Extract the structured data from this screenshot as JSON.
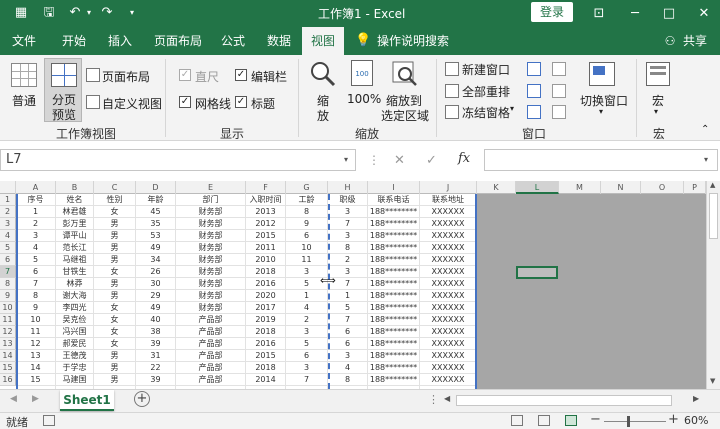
{
  "title": "工作簿1 - Excel",
  "login_label": "登录",
  "tabs": [
    "文件",
    "开始",
    "插入",
    "页面布局",
    "公式",
    "数据",
    "视图",
    "操作说明搜索"
  ],
  "share_label": "共享",
  "ribbon": {
    "views": {
      "normal": "普通",
      "page_break": [
        "分页",
        "预览"
      ],
      "page_layout": "页面布局",
      "custom_views": "自定义视图",
      "label": "工作簿视图"
    },
    "show": {
      "ruler": "直尺",
      "gridlines": "网格线",
      "formula_bar": "编辑栏",
      "headings": "标题",
      "label": "显示"
    },
    "zoom": {
      "zoom": [
        "缩",
        "放"
      ],
      "hundred": "100%",
      "zoom_sel": [
        "缩放到",
        "选定区域"
      ],
      "label": "缩放"
    },
    "window": {
      "new_window": "新建窗口",
      "arrange_all": "全部重排",
      "freeze": "冻结窗格",
      "switch": "切换窗口",
      "label": "窗口"
    },
    "macros": {
      "macro": "宏",
      "label": "宏"
    }
  },
  "formula_bar": {
    "name_box": "L7",
    "cancel_icon": "✕",
    "enter_icon": "✓",
    "fx": "fx"
  },
  "columns": [
    "A",
    "B",
    "C",
    "D",
    "E",
    "F",
    "G",
    "H",
    "I",
    "J",
    "K",
    "L",
    "M",
    "N",
    "O",
    "P"
  ],
  "rows": [
    [
      "序号",
      "姓名",
      "性别",
      "年龄",
      "部门",
      "入职时间",
      "工龄",
      "职级",
      "联系电话",
      "联系地址"
    ],
    [
      "1",
      "林君雄",
      "女",
      "45",
      "财务部",
      "2013",
      "8",
      "3",
      "188********",
      "XXXXXX"
    ],
    [
      "2",
      "彭万里",
      "男",
      "35",
      "财务部",
      "2012",
      "9",
      "7",
      "188********",
      "XXXXXX"
    ],
    [
      "3",
      "谭平山",
      "男",
      "53",
      "财务部",
      "2015",
      "6",
      "3",
      "188********",
      "XXXXXX"
    ],
    [
      "4",
      "范长江",
      "男",
      "49",
      "财务部",
      "2011",
      "10",
      "8",
      "188********",
      "XXXXXX"
    ],
    [
      "5",
      "马继祖",
      "男",
      "34",
      "财务部",
      "2010",
      "11",
      "2",
      "188********",
      "XXXXXX"
    ],
    [
      "6",
      "甘铁生",
      "女",
      "26",
      "财务部",
      "2018",
      "3",
      "3",
      "188********",
      "XXXXXX"
    ],
    [
      "7",
      "林莽",
      "男",
      "30",
      "财务部",
      "2016",
      "5",
      "7",
      "188********",
      "XXXXXX"
    ],
    [
      "8",
      "谢大海",
      "男",
      "29",
      "财务部",
      "2020",
      "1",
      "1",
      "188********",
      "XXXXXX"
    ],
    [
      "9",
      "李四光",
      "女",
      "49",
      "财务部",
      "2017",
      "4",
      "5",
      "188********",
      "XXXXXX"
    ],
    [
      "10",
      "吴克俭",
      "女",
      "40",
      "产品部",
      "2019",
      "2",
      "7",
      "188********",
      "XXXXXX"
    ],
    [
      "11",
      "冯兴国",
      "女",
      "38",
      "产品部",
      "2018",
      "3",
      "6",
      "188********",
      "XXXXXX"
    ],
    [
      "12",
      "郝爱民",
      "女",
      "39",
      "产品部",
      "2016",
      "5",
      "6",
      "188********",
      "XXXXXX"
    ],
    [
      "13",
      "王德茂",
      "男",
      "31",
      "产品部",
      "2015",
      "6",
      "3",
      "188********",
      "XXXXXX"
    ],
    [
      "14",
      "于学忠",
      "男",
      "22",
      "产品部",
      "2018",
      "3",
      "4",
      "188********",
      "XXXXXX"
    ],
    [
      "15",
      "马建国",
      "男",
      "39",
      "产品部",
      "2014",
      "7",
      "8",
      "188********",
      "XXXXXX"
    ]
  ],
  "row_numbers": [
    "1",
    "2",
    "3",
    "4",
    "5",
    "6",
    "7",
    "8",
    "9",
    "10",
    "11",
    "12",
    "13",
    "14",
    "15",
    "16"
  ],
  "sheet_tab": "Sheet1",
  "status": {
    "ready": "就绪",
    "zoom": "60%"
  },
  "colors": {
    "brand": "#227447",
    "tab_active_text": "#217346",
    "page_break_line": "#4472c4"
  }
}
